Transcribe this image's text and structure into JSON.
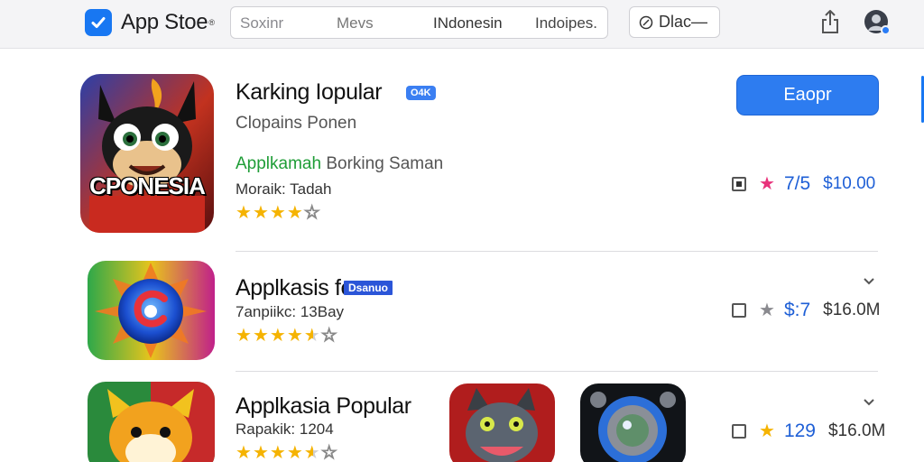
{
  "header": {
    "app_name": "App Stoe",
    "trademark": "®",
    "search_segments": [
      "Soxinr",
      "Mevs",
      "INdonesin",
      "Indoipes."
    ],
    "filter_label": "Dlac—"
  },
  "colors": {
    "accent": "#2d7cf0",
    "brand": "#1877f2",
    "star": "#f5b301",
    "pink_star": "#e8317a",
    "green_text": "#1f9d37"
  },
  "featured": {
    "title": "Karking Iopular",
    "badge": "O4K",
    "subtitle": "Clopains Ponen",
    "developer_green": "Applkamah",
    "developer_rest": " Borking Saman",
    "meta": "Moraik: Tadah",
    "rating_stars": 4.0,
    "get_button": "Eaopr",
    "icon_text": "CPONESIA",
    "right_rating": "7/5",
    "price": "$10.00",
    "rating_color": "#1e5fd6"
  },
  "apps": [
    {
      "title": "Applkasis fe",
      "badge": "Dsanuo",
      "meta": "7anpiikc: 13Bay",
      "rating_stars": 4.5,
      "right_rating": "$:7",
      "price": "$16.0M"
    },
    {
      "title": "Applkasia Popular",
      "meta": "Rapakik: 1204",
      "rating_stars": 4.5,
      "right_rating": "129",
      "price": "$16.0M"
    }
  ]
}
